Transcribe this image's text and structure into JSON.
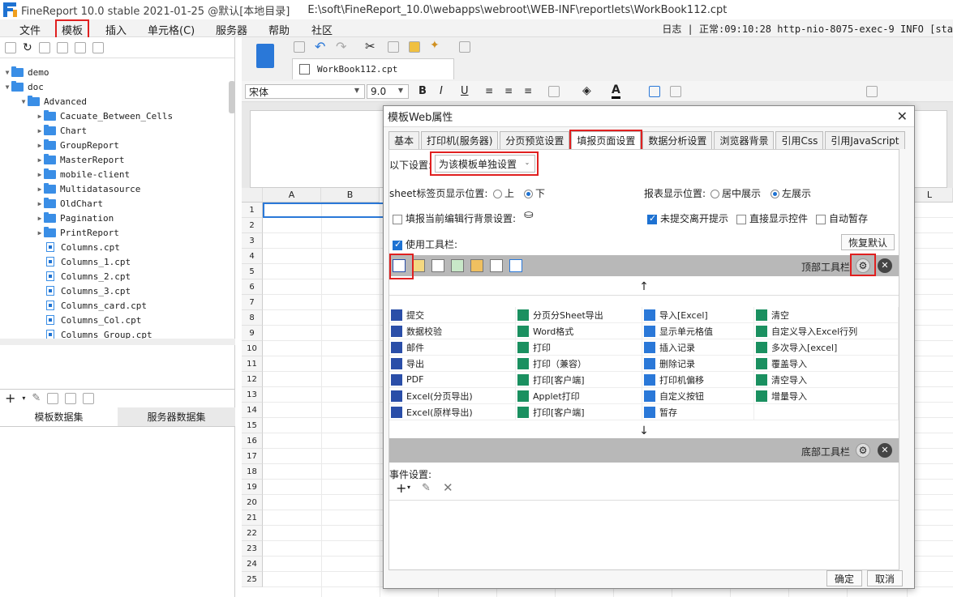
{
  "app": {
    "title": "FineReport 10.0 stable 2021-01-25 @默认[本地目录]",
    "path": "E:\\soft\\FineReport_10.0\\webapps\\webroot\\WEB-INF\\reportlets\\WorkBook112.cpt"
  },
  "menu": {
    "items": [
      "文件",
      "模板",
      "插入",
      "单元格(C)",
      "服务器",
      "帮助",
      "社区"
    ],
    "status": "日志 | 正常:09:10:28 http-nio-8075-exec-9 INFO [sta"
  },
  "tree": {
    "items": [
      {
        "label": "demo",
        "type": "folder",
        "level": 0
      },
      {
        "label": "doc",
        "type": "folder",
        "level": 0
      },
      {
        "label": "Advanced",
        "type": "folder",
        "level": 1
      },
      {
        "label": "Cacuate_Between_Cells",
        "type": "folder",
        "level": 2
      },
      {
        "label": "Chart",
        "type": "folder",
        "level": 2
      },
      {
        "label": "GroupReport",
        "type": "folder",
        "level": 2
      },
      {
        "label": "MasterReport",
        "type": "folder",
        "level": 2
      },
      {
        "label": "mobile-client",
        "type": "folder",
        "level": 2
      },
      {
        "label": "Multidatasource",
        "type": "folder",
        "level": 2
      },
      {
        "label": "OldChart",
        "type": "folder",
        "level": 2
      },
      {
        "label": "Pagination",
        "type": "folder",
        "level": 2
      },
      {
        "label": "PrintReport",
        "type": "folder",
        "level": 2
      },
      {
        "label": "Columns.cpt",
        "type": "file",
        "level": 2
      },
      {
        "label": "Columns_1.cpt",
        "type": "file",
        "level": 2
      },
      {
        "label": "Columns_2.cpt",
        "type": "file",
        "level": 2
      },
      {
        "label": "Columns_3.cpt",
        "type": "file",
        "level": 2
      },
      {
        "label": "Columns_card.cpt",
        "type": "file",
        "level": 2
      },
      {
        "label": "Columns_Col.cpt",
        "type": "file",
        "level": 2
      },
      {
        "label": "Columns_Group.cpt",
        "type": "file",
        "level": 2
      }
    ]
  },
  "datasets": {
    "template": "模板数据集",
    "server": "服务器数据集"
  },
  "editor": {
    "doc_tab": "WorkBook112.cpt",
    "font": "宋体",
    "font_size": "9.0",
    "columns": [
      "A",
      "B",
      "L"
    ],
    "rows": [
      "1",
      "2",
      "3",
      "4",
      "5",
      "6",
      "7",
      "8",
      "9",
      "10",
      "11",
      "12",
      "13",
      "14",
      "15",
      "16",
      "17",
      "18",
      "19",
      "20",
      "21",
      "22",
      "23",
      "24",
      "25"
    ]
  },
  "dialog": {
    "title": "模板Web属性",
    "tabs": [
      "基本",
      "打印机(服务器)",
      "分页预览设置",
      "填报页面设置",
      "数据分析设置",
      "浏览器背景",
      "引用Css",
      "引用JavaScript"
    ],
    "setting_label": "以下设置:",
    "setting_value": "为该模板单独设置",
    "sheet_pos_label": "sheet标签页显示位置:",
    "sheet_pos_up": "上",
    "sheet_pos_down": "下",
    "report_pos_label": "报表显示位置:",
    "report_center": "居中展示",
    "report_left": "左展示",
    "fill_bg": "填报当前编辑行背景设置:",
    "no_submit_tip": "未提交离开提示",
    "direct_widget": "直接显示控件",
    "auto_save": "自动暂存",
    "use_toolbar": "使用工具栏:",
    "restore_default": "恢复默认",
    "top_toolbar": "顶部工具栏",
    "bottom_toolbar": "底部工具栏",
    "event_label": "事件设置:",
    "ok": "确定",
    "cancel": "取消",
    "buttons": [
      [
        "提交",
        "分页分Sheet导出",
        "导入[Excel]",
        "清空"
      ],
      [
        "数据校验",
        "Word格式",
        "显示单元格值",
        "自定义导入Excel行列"
      ],
      [
        "邮件",
        "打印",
        "插入记录",
        "多次导入[excel]"
      ],
      [
        "导出",
        "打印（兼容）",
        "删除记录",
        "覆盖导入"
      ],
      [
        "PDF",
        "打印[客户端]",
        "打印机偏移",
        "清空导入"
      ],
      [
        "Excel(分页导出)",
        "Applet打印",
        "自定义按钮",
        "增量导入"
      ],
      [
        "Excel(原样导出)",
        "打印[客户端]",
        "暂存",
        ""
      ]
    ]
  }
}
